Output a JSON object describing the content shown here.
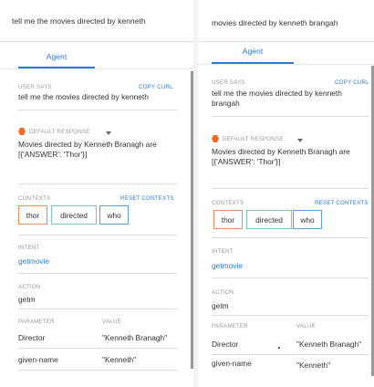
{
  "panels": [
    {
      "query": "tell me the movies directed by kenneth",
      "tab_label": "Agent",
      "user_says_label": "USER SAYS",
      "copy_curl_label": "COPY CURL",
      "user_says_text": "tell me the movies directed by kenneth",
      "default_response_label": "DEFAULT RESPONSE",
      "response_text_line1": "Movies directed by Kenneth Branagh are",
      "response_text_line2": "[{'ANSWER': 'Thor'}]",
      "contexts_label": "CONTEXTS",
      "reset_contexts_label": "RESET CONTEXTS",
      "contexts": [
        "thor",
        "directed",
        "who"
      ],
      "intent_label": "INTENT",
      "intent_value": "getmovie",
      "action_label": "ACTION",
      "action_value": "getm",
      "parameter_col_label": "PARAMETER",
      "value_col_label": "VALUE",
      "parameters": [
        {
          "name": "Director",
          "value": "\"Kenneth Branagh\""
        },
        {
          "name": "given-name",
          "value": "\"Kenneth\""
        }
      ]
    },
    {
      "query": "movies directed by kenneth brangah",
      "tab_label": "Agent",
      "user_says_label": "USER SAYS",
      "copy_curl_label": "COPY CURL",
      "user_says_line1": "tell me the movies directed by kenneth",
      "user_says_line2": "brangah",
      "default_response_label": "DEFAULT RESPONSE",
      "response_text_line1": "Movies directed by Kenneth Branagh are",
      "response_text_line2": "[{'ANSWER': 'Thor'}]",
      "contexts_label": "CONTEXTS",
      "reset_contexts_label": "RESET CONTEXTS",
      "contexts": [
        "thor",
        "directed",
        "who"
      ],
      "intent_label": "INTENT",
      "intent_value": "getmovie",
      "action_label": "ACTION",
      "action_value": "getm",
      "parameter_col_label": "PARAMETER",
      "value_col_label": "VALUE",
      "parameters": [
        {
          "name": "Director",
          "value": "\"Kenneth Branagh\""
        },
        {
          "name": "given-name",
          "value": "\"Kenneth\""
        }
      ]
    }
  ],
  "colors": {
    "accent": "#2b7cd3",
    "chip_thor": "#f08a5d",
    "chip_directed": "#7fc8b2",
    "chip_who": "#5aa0e0",
    "response_icon": "#f06c22"
  },
  "icons": {
    "response": "hexagon-icon",
    "dropdown": "caret-down-icon"
  }
}
